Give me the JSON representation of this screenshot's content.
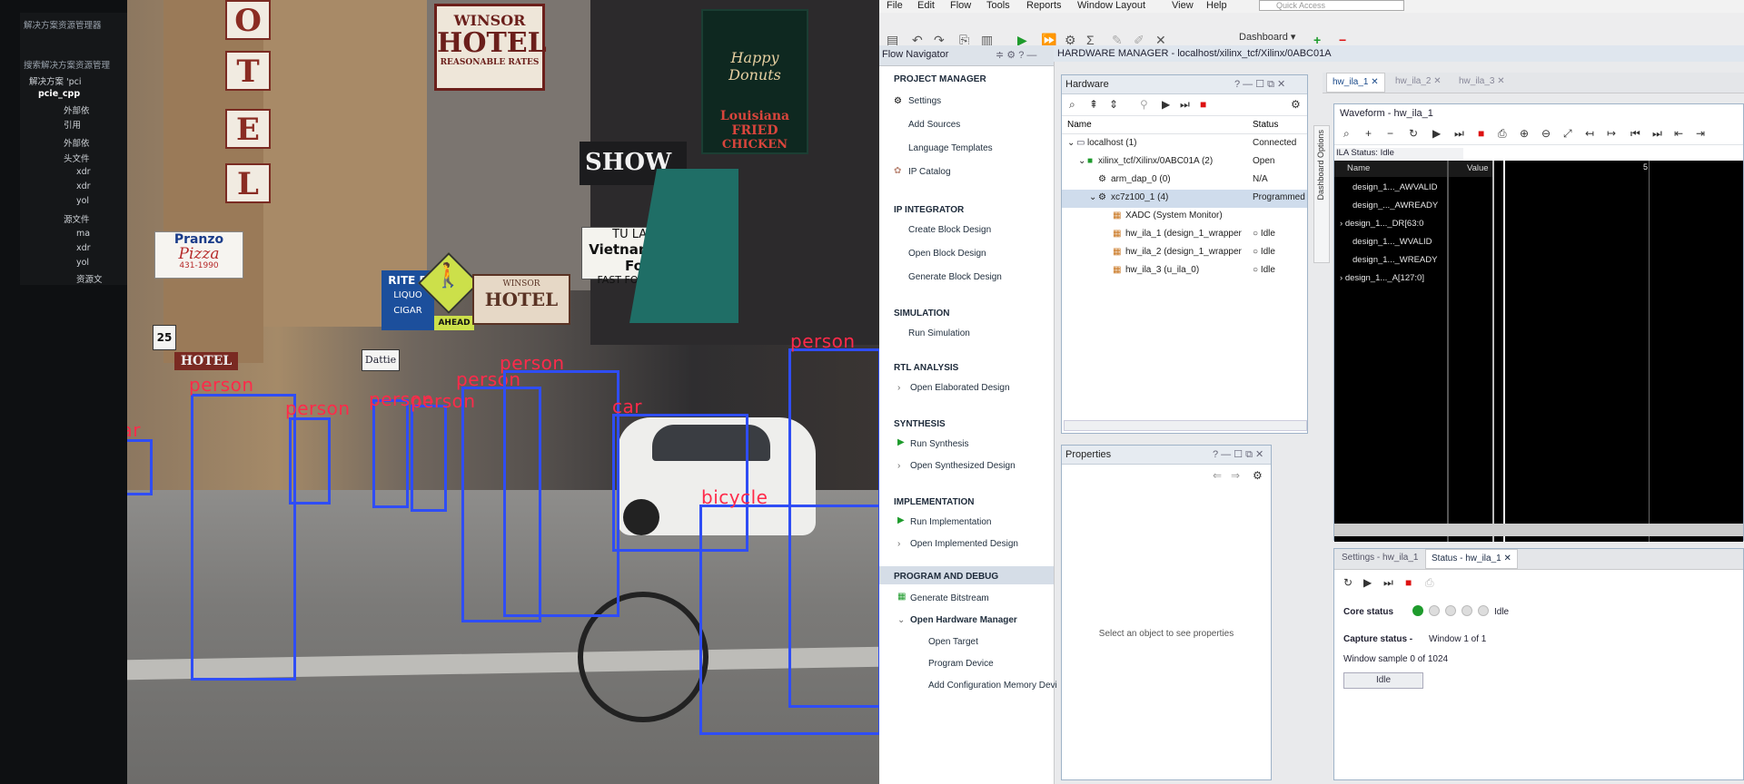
{
  "ide_tree": {
    "title": "解决方案资源管理器",
    "search": "搜索解决方案资源管理",
    "items": [
      "解决方案 'pci",
      "pcie_cpp",
      "外部依",
      "引用",
      "外部依",
      "头文件",
      "xdr",
      "xdr",
      "yol",
      "源文件",
      "ma",
      "xdr",
      "yol",
      "资源文"
    ]
  },
  "photo": {
    "signs": {
      "hotel_letters": [
        "O",
        "T",
        "E",
        "L"
      ],
      "winsor_top": "WINSOR",
      "hotel_big": "HOTEL",
      "reasonable": "REASONABLE RATES",
      "happy_donuts": "Happy Donuts",
      "louisiana": "Louisiana FRIED",
      "chicken": "CHICKEN",
      "show": "SHOW",
      "tu_lan": "TU LAN",
      "vietnamese": "Vietnamese Fo",
      "fast_food": "FAST FOOD TO",
      "pranzo": "Pranzo",
      "pizza": "Pizza",
      "phone": "431-1990",
      "rite": "RITE B",
      "liquor": "LIQUO",
      "cigar": "CIGAR",
      "winsor_small": "WINSOR",
      "hotel_small": "HOTEL",
      "ahead": "AHEAD",
      "hotel_vert": "HOTEL",
      "speed": "25",
      "dattie": "Dattie"
    },
    "detections": [
      "car",
      "person",
      "person",
      "person",
      "person",
      "person",
      "person",
      "car",
      "bicycle",
      "person"
    ]
  },
  "vivado": {
    "menu": [
      "File",
      "Edit",
      "Flow",
      "Tools",
      "Reports",
      "Window",
      "Layout",
      "View",
      "Help"
    ],
    "quick_access": "Quick Access",
    "dashboard_label": "Dashboard",
    "flow_navigator": {
      "title": "Flow Navigator",
      "sections": [
        {
          "title": "PROJECT MANAGER",
          "items": [
            "Settings",
            "Add Sources",
            "Language Templates",
            "IP Catalog"
          ]
        },
        {
          "title": "IP INTEGRATOR",
          "items": [
            "Create Block Design",
            "Open Block Design",
            "Generate Block Design"
          ]
        },
        {
          "title": "SIMULATION",
          "items": [
            "Run Simulation"
          ]
        },
        {
          "title": "RTL ANALYSIS",
          "items": [
            "Open Elaborated Design"
          ]
        },
        {
          "title": "SYNTHESIS",
          "items": [
            "Run Synthesis",
            "Open Synthesized Design"
          ]
        },
        {
          "title": "IMPLEMENTATION",
          "items": [
            "Run Implementation",
            "Open Implemented Design"
          ]
        },
        {
          "title": "PROGRAM AND DEBUG",
          "items": [
            "Generate Bitstream",
            "Open Hardware Manager",
            "Open Target",
            "Program Device",
            "Add Configuration Memory Devi"
          ]
        }
      ]
    },
    "hw_manager_title": "HARDWARE MANAGER - localhost/xilinx_tcf/Xilinx/0ABC01A",
    "hardware_panel": {
      "title": "Hardware",
      "col_name": "Name",
      "col_status": "Status",
      "rows": [
        {
          "name": "localhost (1)",
          "status": "Connected"
        },
        {
          "name": "xilinx_tcf/Xilinx/0ABC01A (2)",
          "status": "Open"
        },
        {
          "name": "arm_dap_0 (0)",
          "status": "N/A"
        },
        {
          "name": "xc7z100_1 (4)",
          "status": "Programmed"
        },
        {
          "name": "XADC (System Monitor)",
          "status": ""
        },
        {
          "name": "hw_ila_1 (design_1_wrapper",
          "status": "Idle"
        },
        {
          "name": "hw_ila_2 (design_1_wrapper",
          "status": "Idle"
        },
        {
          "name": "hw_ila_3 (u_ila_0)",
          "status": "Idle"
        }
      ]
    },
    "properties_panel": {
      "title": "Properties",
      "empty": "Select an object to see properties"
    },
    "dashboard_side": "Dashboard Options",
    "ila_tabs": [
      "hw_ila_1",
      "hw_ila_2",
      "hw_ila_3"
    ],
    "waveform": {
      "title": "Waveform - hw_ila_1",
      "ila_status": "ILA Status: Idle",
      "col_name": "Name",
      "col_value": "Value",
      "marker": "5",
      "signals": [
        "design_1..._AWVALID",
        "design_..._AWREADY",
        "design_1..._DR[63:0",
        "design_1..._WVALID",
        "design_1..._WREADY",
        "design_1..._A[127:0]"
      ]
    },
    "status_tabs": [
      "Settings - hw_ila_1",
      "Status - hw_ila_1"
    ],
    "status": {
      "core_status_label": "Core status",
      "core_status_value": "Idle",
      "capture_status_label": "Capture status -",
      "capture_status_value": "Window 1 of 1",
      "window_sample": "Window sample 0 of 1024",
      "idle_button": "Idle"
    }
  }
}
